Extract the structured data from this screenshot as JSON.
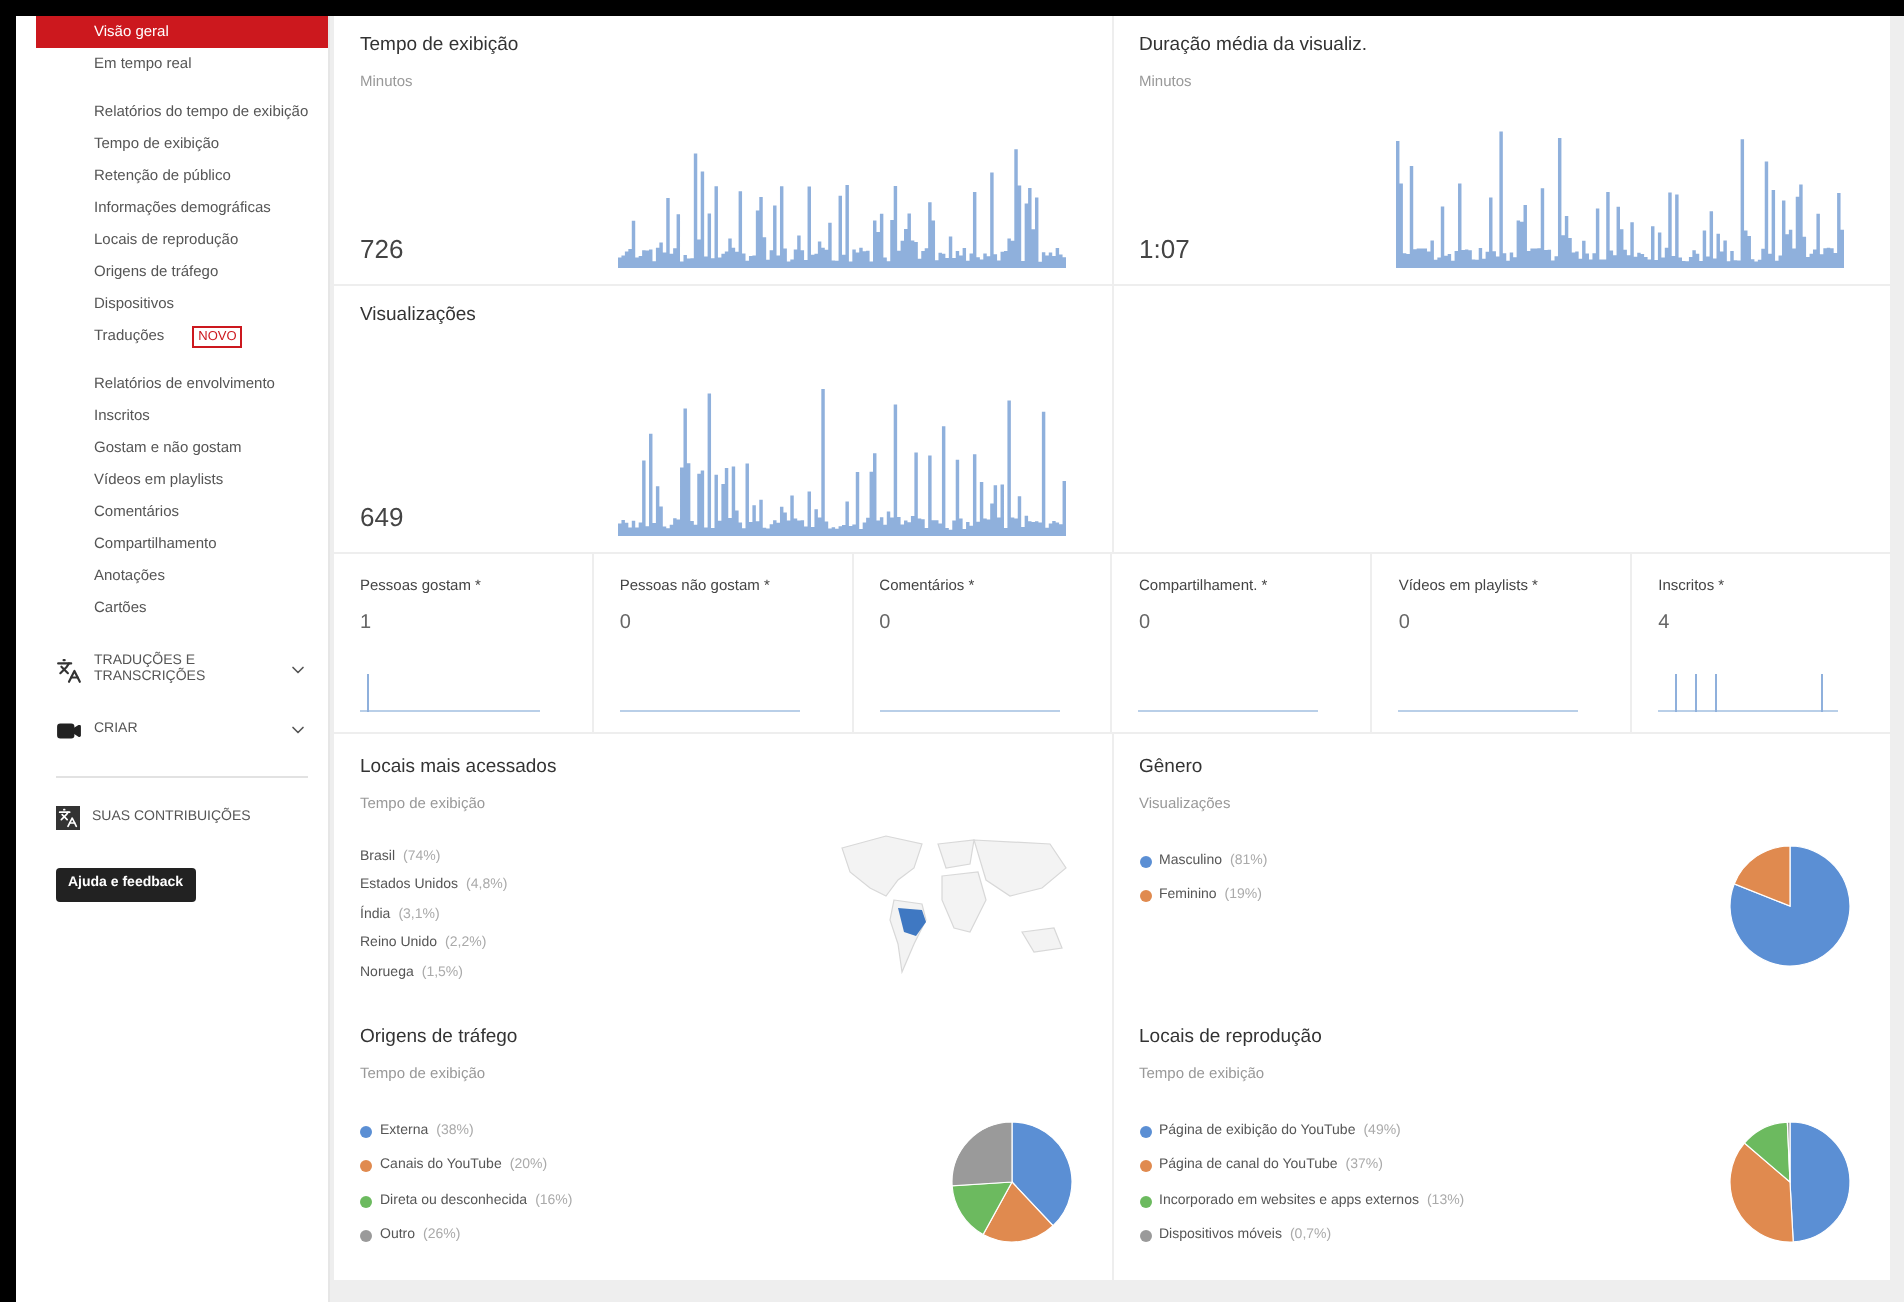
{
  "sidebar": {
    "groups": [
      {
        "items": [
          {
            "label": "Visão geral",
            "selected": true
          },
          {
            "label": "Em tempo real",
            "selected": false
          }
        ]
      },
      {
        "items": [
          {
            "label": "Relatórios do tempo de exibição",
            "selected": false
          },
          {
            "label": "Tempo de exibição",
            "selected": false
          },
          {
            "label": "Retenção de público",
            "selected": false
          },
          {
            "label": "Informações demográficas",
            "selected": false
          },
          {
            "label": "Locais de reprodução",
            "selected": false
          },
          {
            "label": "Origens de tráfego",
            "selected": false
          },
          {
            "label": "Dispositivos",
            "selected": false
          },
          {
            "label": "Traduções",
            "selected": false,
            "badge": "NOVO"
          }
        ]
      },
      {
        "items": [
          {
            "label": "Relatórios de envolvimento",
            "selected": false
          },
          {
            "label": "Inscritos",
            "selected": false
          },
          {
            "label": "Gostam e não gostam",
            "selected": false
          },
          {
            "label": "Vídeos em playlists",
            "selected": false
          },
          {
            "label": "Comentários",
            "selected": false
          },
          {
            "label": "Compartilhamento",
            "selected": false
          },
          {
            "label": "Anotações",
            "selected": false
          },
          {
            "label": "Cartões",
            "selected": false
          }
        ]
      }
    ],
    "sections": [
      {
        "kind": "translate",
        "label": "TRADUÇÕES E TRANSCRIÇÕES",
        "expanded": false
      },
      {
        "kind": "camera",
        "label": "CRIAR",
        "expanded": false
      }
    ],
    "contributions": "SUAS CONTRIBUIÇÕES",
    "help_button": "Ajuda e feedback"
  },
  "big_cards": [
    {
      "title": "Tempo de exibição",
      "subtitle": "Minutos",
      "value": "726"
    },
    {
      "title": "Duração média da visualiz.",
      "subtitle": "Minutos",
      "value": "1:07"
    },
    {
      "title": "Visualizações",
      "value": "649"
    }
  ],
  "metrics": [
    {
      "label": "Pessoas gostam *",
      "value": "1"
    },
    {
      "label": "Pessoas não gostam *",
      "value": "0"
    },
    {
      "label": "Comentários *",
      "value": "0"
    },
    {
      "label": "Compartilhament. *",
      "value": "0"
    },
    {
      "label": "Vídeos em playlists *",
      "value": "0"
    },
    {
      "label": "Inscritos *",
      "value": "4"
    }
  ],
  "locations": {
    "title": "Locais mais acessados",
    "subtitle": "Tempo de exibição",
    "items": [
      {
        "label": "Brasil",
        "share": "(74%)"
      },
      {
        "label": "Estados Unidos",
        "share": "(4,8%)"
      },
      {
        "label": "Índia",
        "share": "(3,1%)"
      },
      {
        "label": "Reino Unido",
        "share": "(2,2%)"
      },
      {
        "label": "Noruega",
        "share": "(1,5%)"
      }
    ]
  },
  "pie_cards": [
    {
      "title": "Gênero",
      "subtitle": "Visualizações",
      "legend": [
        {
          "share": "(81%)",
          "color": "#5b8fd4"
        },
        {
          "share": "(19%)",
          "color": "#e08a4f"
        }
      ],
      "chart_data": {
        "type": "pie",
        "categories": [
          "Masculino",
          "Feminino"
        ],
        "values": [
          81,
          19
        ]
      }
    },
    {
      "title": "Origens de tráfego",
      "subtitle": "Tempo de exibição",
      "legend": [
        {
          "share": "(38%)",
          "color": "#5b8fd4"
        },
        {
          "share": "(20%)",
          "color": "#e08a4f"
        },
        {
          "share": "(16%)",
          "color": "#6cba5f"
        },
        {
          "share": "(26%)",
          "color": "#9a9a9a"
        }
      ],
      "chart_data": {
        "type": "pie",
        "categories": [
          "Externa",
          "Canais do YouTube",
          "Direta ou desconhecida",
          "Outro"
        ],
        "values": [
          38,
          20,
          16,
          26
        ]
      }
    },
    {
      "title": "Locais de reprodução",
      "subtitle": "Tempo de exibição",
      "legend": [
        {
          "share": "(49%)",
          "color": "#5b8fd4"
        },
        {
          "share": "(37%)",
          "color": "#e08a4f"
        },
        {
          "share": "(13%)",
          "color": "#6cba5f"
        },
        {
          "share": "(0,7%)",
          "color": "#9a9a9a"
        }
      ],
      "chart_data": {
        "type": "pie",
        "categories": [
          "Página de exibição do YouTube",
          "Página de canal do YouTube",
          "Incorporado em websites e apps externos",
          "Dispositivos móveis"
        ],
        "values": [
          49,
          37,
          13,
          0.7
        ]
      }
    }
  ]
}
